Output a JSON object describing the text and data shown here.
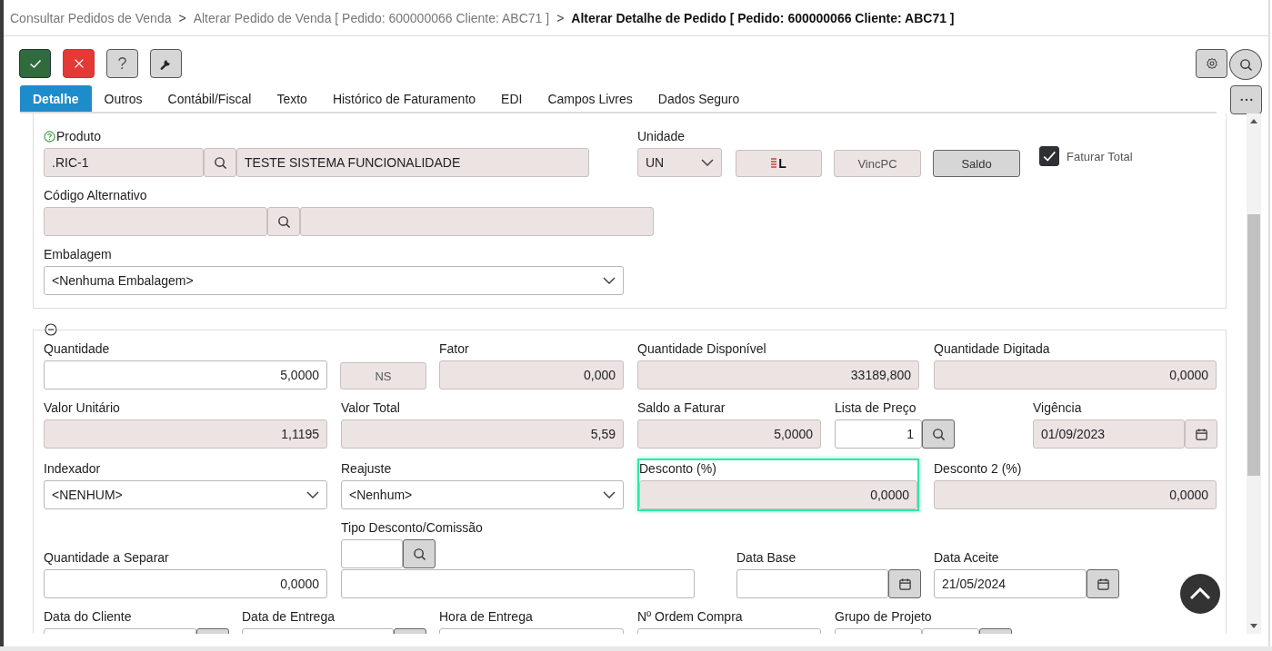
{
  "breadcrumb": [
    {
      "label": "Consultar Pedidos de Venda",
      "current": false
    },
    {
      "prefix": ">",
      "label": "Alterar Pedido de Venda [ Pedido: 600000066 Cliente: ABC71 ]",
      "current": false
    },
    {
      "prefix": ">",
      "label": "Alterar Detalhe de Pedido [ Pedido: 600000066 Cliente: ABC71 ]",
      "current": true
    }
  ],
  "toolbar": [
    {
      "kind": "confirm"
    },
    {
      "kind": "cancel"
    },
    {
      "kind": "help",
      "label": "?"
    },
    {
      "kind": "tools"
    }
  ],
  "tabs": [
    {
      "label": "Detalhe",
      "selected": true
    },
    {
      "label": "Outros",
      "selected": false
    },
    {
      "label": "Contábil/Fiscal",
      "selected": false
    },
    {
      "label": "Texto",
      "selected": false
    },
    {
      "label": "Histórico de Faturamento",
      "selected": false
    },
    {
      "label": "EDI",
      "selected": false
    },
    {
      "label": "Campos Livres",
      "selected": false
    },
    {
      "label": "Dados Seguro",
      "selected": false
    }
  ],
  "sections": [
    {
      "collapsible": false,
      "lines": [
        {
          "fields": [
            {
              "kind": "lookup",
              "label": "Produto",
              "help": true,
              "value": ".RIC-1",
              "description": "TESTE SISTEMA FUNCIONALIDADE",
              "readonly": true
            },
            {
              "kind": "select",
              "label": "Unidade",
              "value": "UN",
              "readonly": true
            },
            {
              "kind": "button",
              "text": "L",
              "icon": true,
              "disabled": true
            },
            {
              "kind": "button",
              "text": "VincPC",
              "disabled": true
            },
            {
              "kind": "button",
              "text": "Saldo",
              "disabled": false
            },
            {
              "kind": "checkbox",
              "label": "Faturar Total",
              "checked": true
            }
          ]
        },
        {
          "fields": [
            {
              "kind": "lookup",
              "label": "Código Alternativo",
              "help": false,
              "readonly": true
            }
          ]
        },
        {
          "fields": [
            {
              "kind": "select",
              "label": "Embalagem",
              "value": "<Nenhuma Embalagem>",
              "readonly": false
            }
          ]
        }
      ]
    },
    {
      "collapsible": true,
      "lines": [
        {
          "fields": [
            {
              "kind": "number",
              "label": "Quantidade",
              "value": "5,0000",
              "readonly": false
            },
            {
              "kind": "button",
              "text": "NS",
              "disabled": true
            },
            {
              "kind": "number",
              "label": "Fator",
              "value": "0,000",
              "readonly": true
            },
            {
              "kind": "number",
              "label": "Quantidade Disponível",
              "value": "33189,800",
              "readonly": true
            },
            {
              "kind": "number",
              "label": "Quantidade Digitada",
              "value": "0,0000",
              "readonly": true
            }
          ]
        },
        {
          "fields": [
            {
              "kind": "number",
              "label": "Valor Unitário",
              "value": "1,1195",
              "readonly": true
            },
            {
              "kind": "number",
              "label": "Valor Total",
              "value": "5,59",
              "readonly": true
            },
            {
              "kind": "number",
              "label": "Saldo a Faturar",
              "value": "5,0000",
              "readonly": true
            },
            {
              "kind": "lookup",
              "label": "Lista de Preço",
              "help": false,
              "value": "1",
              "readonly": false,
              "numeric": true
            },
            {
              "kind": "date",
              "label": "Vigência",
              "value": "01/09/2023",
              "readonly": true
            }
          ]
        },
        {
          "fields": [
            {
              "kind": "select",
              "label": "Indexador",
              "value": "<NENHUM>",
              "readonly": false
            },
            {
              "kind": "select",
              "label": "Reajuste",
              "value": "<Nenhum>",
              "readonly": false
            },
            {
              "kind": "number",
              "label": "Desconto (%)",
              "value": "0,0000",
              "readonly": true,
              "focused": true
            },
            {
              "kind": "number",
              "label": "Desconto 2 (%)",
              "value": "0,0000",
              "readonly": true
            }
          ]
        },
        {
          "fields": [
            {
              "kind": "number",
              "label": "Quantidade a Separar",
              "value": "0,0000",
              "readonly": false
            },
            {
              "kind": "lookup_stacked",
              "label": "Tipo Desconto/Comissão",
              "readonly": false
            },
            {
              "kind": "date",
              "label": "Data Base",
              "readonly": false
            },
            {
              "kind": "date",
              "label": "Data Aceite",
              "value": "21/05/2024",
              "readonly": false
            }
          ]
        },
        {
          "fields": [
            {
              "kind": "date",
              "label": "Data do Cliente",
              "readonly": false
            },
            {
              "kind": "date",
              "label": "Data de Entrega",
              "readonly": false
            },
            {
              "kind": "text",
              "label": "Hora de Entrega",
              "readonly": false
            },
            {
              "kind": "text",
              "label": "Nº Ordem Compra",
              "readonly": false
            },
            {
              "kind": "pair_lookup",
              "label": "Grupo de Projeto",
              "readonly": false
            }
          ]
        }
      ]
    }
  ]
}
